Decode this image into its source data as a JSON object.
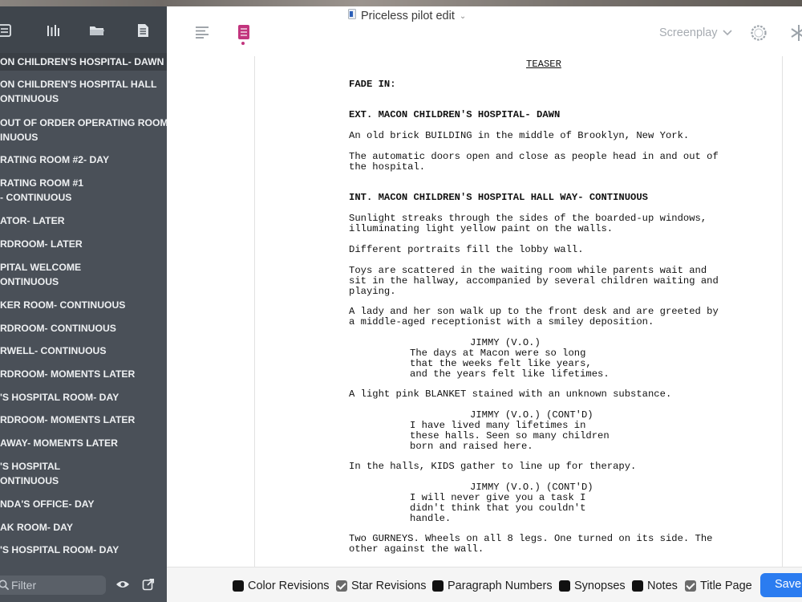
{
  "document": {
    "title": "Priceless pilot edit"
  },
  "header": {
    "mode_label": "Screenplay"
  },
  "sidebar": {
    "scenes": [
      "ON CHILDREN'S HOSPITAL- DAWN",
      "ON CHILDREN'S HOSPITAL HALL\nONTINUOUS",
      "OUT OF ORDER OPERATING ROOM\nINUOUS",
      "RATING ROOM #2- DAY",
      "RATING ROOM #1\n- CONTINUOUS",
      "ATOR- LATER",
      "RDROOM- LATER",
      "PITAL WELCOME\nONTINUOUS",
      "KER ROOM- CONTINUOUS",
      "RDROOM- CONTINUOUS",
      "RWELL- CONTINUOUS",
      "RDROOM- MOMENTS LATER",
      "'S HOSPITAL ROOM- DAY",
      "RDROOM- MOMENTS LATER",
      "AWAY- MOMENTS LATER",
      "'S HOSPITAL\nONTINUOUS",
      "NDA'S OFFICE- DAY",
      "AK ROOM- DAY",
      "'S HOSPITAL ROOM- DAY"
    ],
    "filter_placeholder": "Filter"
  },
  "script": {
    "title": "TEASER",
    "transition": "FADE IN:",
    "lines": [
      "EXT. MACON CHILDREN'S HOSPITAL- DAWN",
      "An old brick BUILDING in the middle of Brooklyn, New York.",
      "The automatic doors open and close as people head in and out of\nthe hospital.",
      "INT. MACON CHILDREN'S HOSPITAL HALL WAY- CONTINUOUS",
      "Sunlight streaks through the sides of the boarded-up windows,\nilluminating light yellow paint on the walls.",
      "Different portraits fill the lobby wall.",
      "Toys are scattered in the waiting room while parents wait and\nsit in the hallway, accompanied by several children waiting and\nplaying.",
      "A lady and her son walk up to the front desk and are greeted by\na middle-aged receptionist with a smiley deposition.",
      "JIMMY (V.O.)",
      "The days at Macon were so long\nthat the weeks felt like years,\nand the years felt like lifetimes.",
      "A light pink BLANKET stained with an unknown substance.",
      "JIMMY (V.O.) (CONT'D)",
      "I have lived many lifetimes in\nthese halls. Seen so many children\nborn and raised here.",
      "In the halls, KIDS gather to line up for therapy.",
      "JIMMY (V.O.) (CONT'D)",
      "I will never give you a task I\ndidn't think that you couldn't\nhandle.",
      "Two GURNEYS. Wheels on all 8 legs. One turned on its side. The\nother against the wall."
    ]
  },
  "bottom_bar": {
    "options": [
      {
        "label": "Color Revisions",
        "checked": false
      },
      {
        "label": "Star Revisions",
        "checked": true
      },
      {
        "label": "Paragraph Numbers",
        "checked": false
      },
      {
        "label": "Synopses",
        "checked": false
      },
      {
        "label": "Notes",
        "checked": false
      },
      {
        "label": "Title Page",
        "checked": true
      }
    ],
    "save_label": "Save"
  },
  "icons": {
    "toolbar": [
      "list-icon",
      "columns-icon",
      "folder-icon",
      "document-icon"
    ],
    "header": [
      "outline-icon",
      "index-cards-icon",
      "chevron-down-icon",
      "gear-icon",
      "sparkle-icon"
    ],
    "footer": [
      "search-icon",
      "eye-icon",
      "open-external-icon"
    ]
  },
  "colors": {
    "sidebar": "#4a5058",
    "accent_pink": "#c2357e",
    "save_button": "#2b7cf0"
  }
}
